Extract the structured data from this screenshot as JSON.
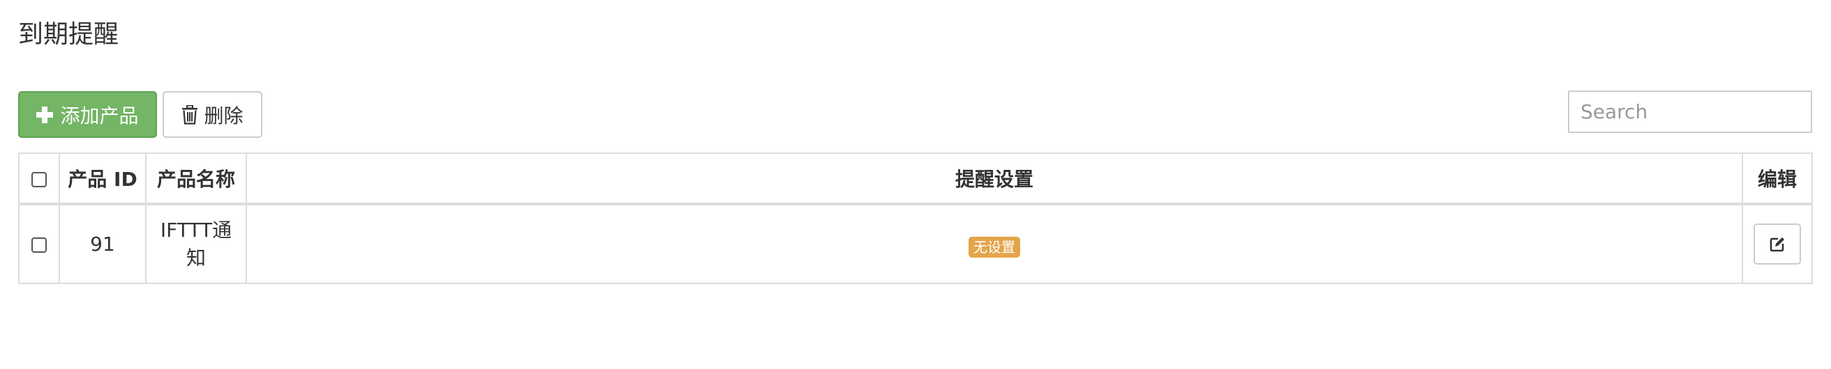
{
  "page": {
    "title": "到期提醒"
  },
  "toolbar": {
    "add_label": "添加产品",
    "add_icon": "plus-icon",
    "delete_label": "删除",
    "delete_icon": "trash-icon",
    "search_placeholder": "Search",
    "search_value": ""
  },
  "table": {
    "headers": {
      "select": "",
      "product_id": "产品 ID",
      "product_name": "产品名称",
      "reminder_settings": "提醒设置",
      "edit": "编辑"
    },
    "rows": [
      {
        "product_id": "91",
        "product_name": "IFTTT通知",
        "reminder_badge": "无设置",
        "edit_icon": "edit-icon"
      }
    ]
  },
  "colors": {
    "add_button": "#74b566",
    "badge_warning": "#e3a54c",
    "border": "#dddddd"
  }
}
